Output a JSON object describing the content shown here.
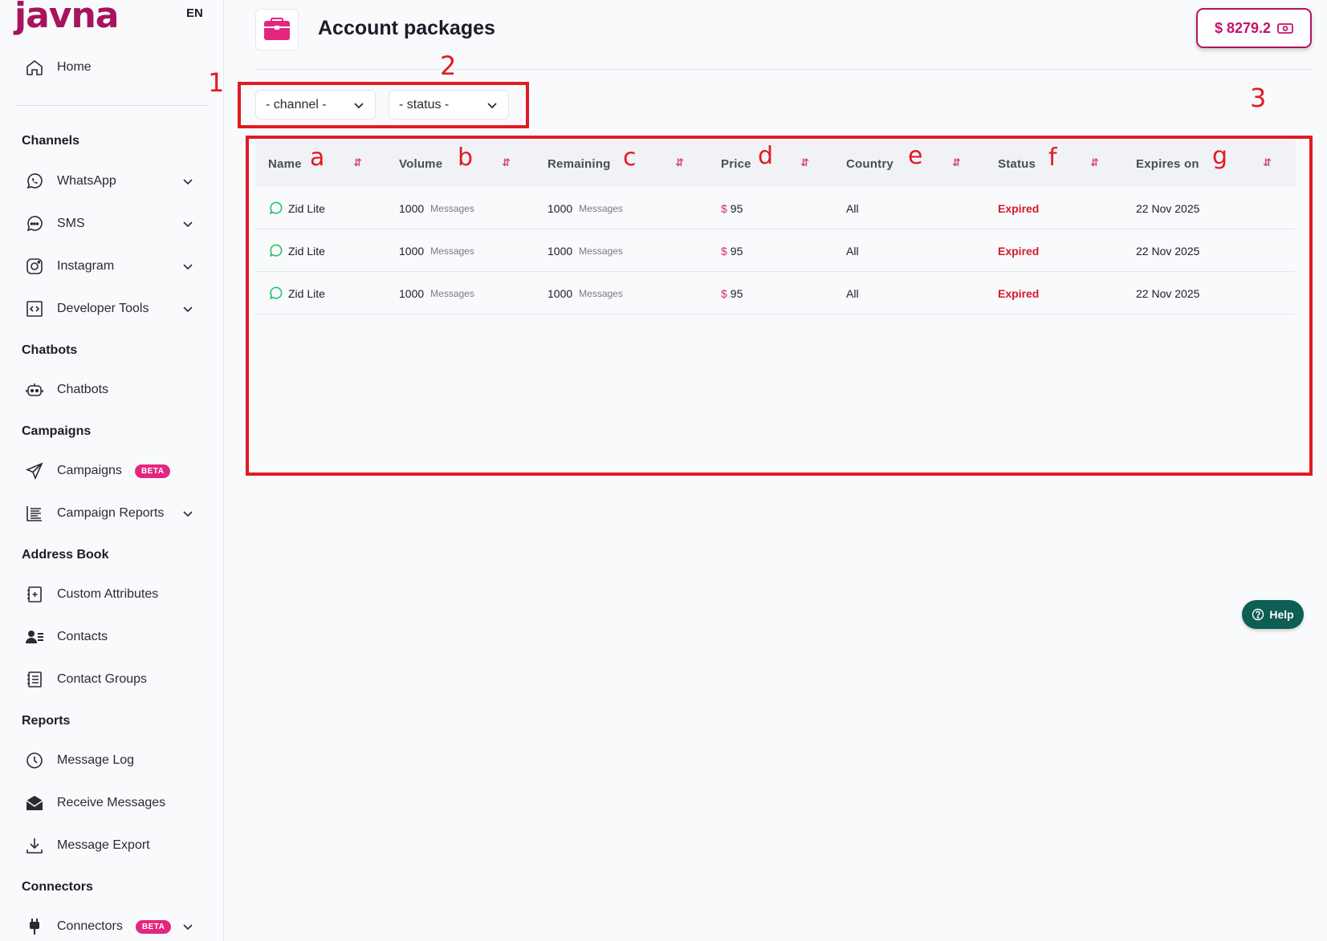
{
  "brand": {
    "logo_text": "javna",
    "language": "EN"
  },
  "sidebar": {
    "home": "Home",
    "sections": {
      "channels": "Channels",
      "chatbots": "Chatbots",
      "campaigns": "Campaigns",
      "address_book": "Address Book",
      "reports": "Reports",
      "connectors": "Connectors"
    },
    "items": {
      "whatsapp": "WhatsApp",
      "sms": "SMS",
      "instagram": "Instagram",
      "developer_tools": "Developer Tools",
      "chatbots": "Chatbots",
      "campaigns": "Campaigns",
      "campaign_reports": "Campaign Reports",
      "custom_attributes": "Custom Attributes",
      "contacts": "Contacts",
      "contact_groups": "Contact Groups",
      "message_log": "Message Log",
      "receive_messages": "Receive Messages",
      "message_export": "Message Export",
      "connectors": "Connectors"
    },
    "beta_label": "BETA"
  },
  "header": {
    "title": "Account packages",
    "balance": "$ 8279.2"
  },
  "filters": {
    "channel": "- channel -",
    "status": "- status -"
  },
  "table": {
    "columns": [
      "Name",
      "Volume",
      "Remaining",
      "Price",
      "Country",
      "Status",
      "Expires on"
    ],
    "rows": [
      {
        "name": "Zid Lite",
        "volume": "1000",
        "volume_unit": "Messages",
        "remaining": "1000",
        "remaining_unit": "Messages",
        "currency": "$",
        "price": "95",
        "country": "All",
        "status": "Expired",
        "expires": "22 Nov 2025"
      },
      {
        "name": "Zid Lite",
        "volume": "1000",
        "volume_unit": "Messages",
        "remaining": "1000",
        "remaining_unit": "Messages",
        "currency": "$",
        "price": "95",
        "country": "All",
        "status": "Expired",
        "expires": "22 Nov 2025"
      },
      {
        "name": "Zid Lite",
        "volume": "1000",
        "volume_unit": "Messages",
        "remaining": "1000",
        "remaining_unit": "Messages",
        "currency": "$",
        "price": "95",
        "country": "All",
        "status": "Expired",
        "expires": "22 Nov 2025"
      }
    ]
  },
  "annotations": {
    "box_labels": [
      "1",
      "2",
      "3"
    ],
    "column_letters": [
      "a",
      "b",
      "c",
      "d",
      "e",
      "f",
      "g"
    ]
  },
  "help": {
    "label": "Help"
  },
  "colors": {
    "brand": "#a7135f",
    "accent": "#e3267f",
    "expired": "#d7192c",
    "help_bg": "#0d5e55",
    "annotation": "#e01b24"
  }
}
